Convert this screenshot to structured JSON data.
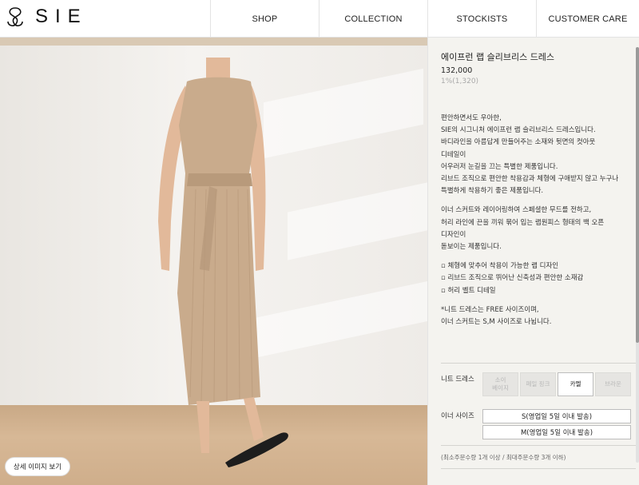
{
  "brand": {
    "name": "SIE"
  },
  "nav": {
    "items": [
      "SHOP",
      "COLLECTION",
      "STOCKISTS",
      "CUSTOMER CARE"
    ]
  },
  "image": {
    "detail_button_label": "상세 이미지 보기"
  },
  "product": {
    "title": "에이프런 랩 슬리브리스 드레스",
    "price": "132,000",
    "points": "1%(1,320)",
    "description": [
      "편안하면서도 우아한,",
      "SIE의 시그니처 에이프런 랩 슬리브리스 드레스입니다.",
      "바디라인을 아름답게 만들어주는 소재와 뒷면의 컷아웃",
      "디테일이",
      "어우러저 눈길을 끄는 특별한 제품입니다.",
      "리브드 조직으로 편안한 착용감과 체형에 구애받지 않고 누구나",
      "특별하게 착용하기 좋은 제품입니다.",
      "",
      "이너 스커트와 레이어링하여 스페셜한 무드를 전하고,",
      "허리 라인에 끈을 끼워 묶어 입는 랩원피스 형태의 백 오픈",
      "디자인이",
      "돋보이는 제품입니다.",
      "",
      "▫ 체형에 맞추어 착용이 가능한 랩 디자인",
      "▫ 리브드 조직으로 뛰어난 신축성과 편안한 소재감",
      "▫ 허리 벨트 디테일",
      "",
      "*니트 드레스는 FREE 사이즈이며,",
      "이너 스커트는 S,M 사이즈로 나뉩니다."
    ]
  },
  "options": {
    "knit_label": "니트 드레스",
    "colors": [
      {
        "label": "소이\n베이지",
        "selected": false
      },
      {
        "label": "페일 핑크",
        "selected": false
      },
      {
        "label": "카멜",
        "selected": true
      },
      {
        "label": "브라운",
        "selected": false
      }
    ],
    "inner_label": "이너 사이즈",
    "sizes": [
      "S(영업일 5일 이내 발송)",
      "M(영업일 5일 이내 발송)"
    ],
    "order_note": "(최소주문수량 1개 이상 / 최대주문수량 3개 이하)"
  }
}
